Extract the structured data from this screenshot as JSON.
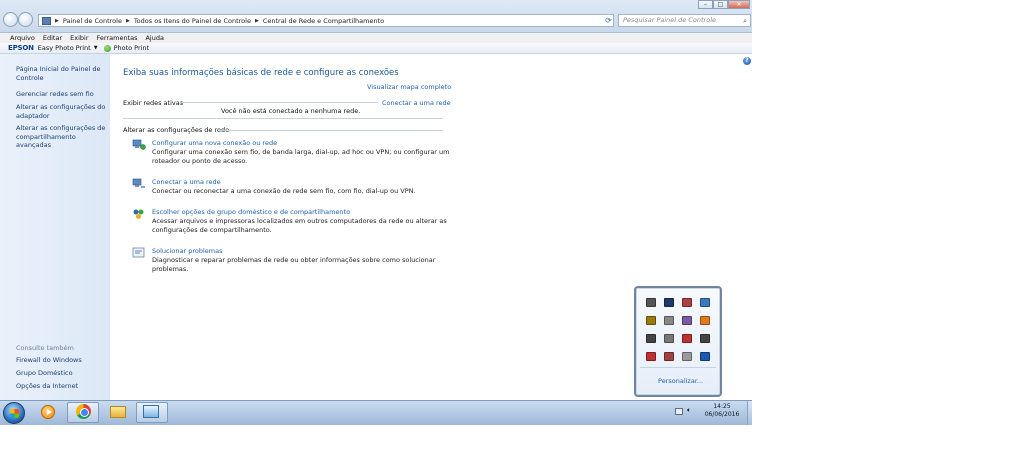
{
  "window": {
    "breadcrumb": [
      "Painel de Controle",
      "Todos os Itens do Painel de Controle",
      "Central de Rede e Compartilhamento"
    ],
    "search_placeholder": "Pesquisar Painel de Controle",
    "controls": [
      "minimize",
      "maximize",
      "close"
    ]
  },
  "menubar": [
    "Arquivo",
    "Editar",
    "Exibir",
    "Ferramentas",
    "Ajuda"
  ],
  "toolbar": {
    "brand": "EPSON",
    "easy_photo_print": "Easy Photo Print",
    "photo_print": "Photo Print"
  },
  "sidebar": {
    "links": [
      "Página Inicial do Painel de Controle",
      "Gerenciar redes sem fio",
      "Alterar as configurações do adaptador",
      "Alterar as configurações de compartilhamento avançadas"
    ],
    "see_also_label": "Consulte também",
    "see_also": [
      "Firewall do Windows",
      "Grupo Doméstico",
      "Opções da Internet"
    ]
  },
  "main": {
    "title": "Exiba suas informações básicas de rede e configure as conexões",
    "view_full_map": "Visualizar mapa completo",
    "active_networks_label": "Exibir redes ativas",
    "no_network": "Você não está conectado a nenhuma rede.",
    "connect_to_network": "Conectar a uma rede",
    "change_settings_label": "Alterar as configurações de rede",
    "tasks": [
      {
        "icon": "network-setup-icon",
        "link": "Configurar uma nova conexão ou rede",
        "desc": "Configurar uma conexão sem fio, de banda larga, dial-up, ad hoc ou VPN; ou configurar um roteador ou ponto de acesso."
      },
      {
        "icon": "network-connect-icon",
        "link": "Conectar a uma rede",
        "desc": "Conectar ou reconectar a uma conexão de rede sem fio, com fio, dial-up ou VPN."
      },
      {
        "icon": "homegroup-icon",
        "link": "Escolher opções de grupo doméstico e de compartilhamento",
        "desc": "Acessar arquivos e impressoras localizados em outros computadores da rede ou alterar as configurações de compartilhamento."
      },
      {
        "icon": "troubleshoot-icon",
        "link": "Solucionar problemas",
        "desc": "Diagnosticar e reparar problemas de rede ou obter informações sobre como solucionar problemas."
      }
    ]
  },
  "taskbar": {
    "time": "14:25",
    "date": "06/06/2016",
    "apps": [
      "media-player-icon",
      "chrome-icon",
      "file-explorer-icon",
      "network-center-icon"
    ]
  },
  "tray_popup": {
    "personalize": "Personalizar...",
    "icons": [
      "display-icon",
      "monitor-icon",
      "app-icon",
      "network-icon",
      "graduation-icon",
      "usb-icon",
      "doc-icon",
      "orange-app-icon",
      "cursor-icon",
      "flag-icon",
      "colorful-app-icon",
      "search-icon",
      "wifi-warning-icon",
      "volume-icon",
      "network-off-icon",
      "bluetooth-icon"
    ],
    "colors": [
      "#555555",
      "#1e3a6a",
      "#b04040",
      "#3a78c0",
      "#9a7a10",
      "#888888",
      "#7a5aa0",
      "#e07a20",
      "#444444",
      "#777777",
      "#c03030",
      "#444444",
      "#c03030",
      "#a04040",
      "#9a9a9a",
      "#1a5ab0"
    ]
  }
}
